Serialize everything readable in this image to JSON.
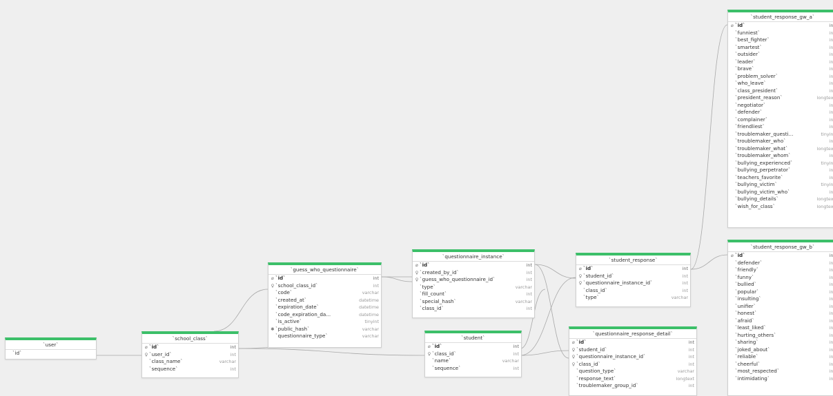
{
  "colors": {
    "canvas": "#efefef",
    "header_accent": "#3cbf69",
    "edge": "#a8a8a8"
  },
  "tables": [
    {
      "id": "user",
      "title": "`user`",
      "columns": [
        {
          "name": "`id`",
          "type": "",
          "key": ""
        }
      ]
    },
    {
      "id": "school_class",
      "title": "`school_class`",
      "columns": [
        {
          "name": "`id`",
          "type": "int",
          "key": "pk"
        },
        {
          "name": "`user_id`",
          "type": "int",
          "key": "fk"
        },
        {
          "name": "`class_name`",
          "type": "varchar",
          "key": ""
        },
        {
          "name": "`sequence`",
          "type": "int",
          "key": ""
        }
      ]
    },
    {
      "id": "guess_who_questionnaire",
      "title": "`guess_who_questionnaire`",
      "columns": [
        {
          "name": "`id`",
          "type": "int",
          "key": "pk"
        },
        {
          "name": "`school_class_id`",
          "type": "int",
          "key": "fk"
        },
        {
          "name": "`code`",
          "type": "varchar",
          "key": ""
        },
        {
          "name": "`created_at`",
          "type": "datetime",
          "key": ""
        },
        {
          "name": "`expiration_date`",
          "type": "datetime",
          "key": ""
        },
        {
          "name": "`code_expiration_da...",
          "type": "datetime",
          "key": ""
        },
        {
          "name": "`is_active`",
          "type": "tinyint",
          "key": ""
        },
        {
          "name": "`public_hash`",
          "type": "varchar",
          "key": "uq"
        },
        {
          "name": "`questionnaire_type`",
          "type": "varchar",
          "key": ""
        }
      ]
    },
    {
      "id": "questionnaire_instance",
      "title": "`questionnaire_instance`",
      "columns": [
        {
          "name": "`id`",
          "type": "int",
          "key": "pk"
        },
        {
          "name": "`created_by_id`",
          "type": "int",
          "key": "fk"
        },
        {
          "name": "`guess_who_questionnaire_id`",
          "type": "int",
          "key": "fk"
        },
        {
          "name": "`type`",
          "type": "varchar",
          "key": ""
        },
        {
          "name": "`fill_count`",
          "type": "int",
          "key": ""
        },
        {
          "name": "`special_hash`",
          "type": "varchar",
          "key": ""
        },
        {
          "name": "`class_id`",
          "type": "int",
          "key": ""
        }
      ]
    },
    {
      "id": "student",
      "title": "`student`",
      "columns": [
        {
          "name": "`id`",
          "type": "int",
          "key": "pk"
        },
        {
          "name": "`class_id`",
          "type": "int",
          "key": "fk"
        },
        {
          "name": "`name`",
          "type": "varchar",
          "key": ""
        },
        {
          "name": "`sequence`",
          "type": "int",
          "key": ""
        }
      ]
    },
    {
      "id": "student_response",
      "title": "`student_response`",
      "columns": [
        {
          "name": "`id`",
          "type": "int",
          "key": "pk"
        },
        {
          "name": "`student_id`",
          "type": "int",
          "key": "fk"
        },
        {
          "name": "`questionnaire_instance_id`",
          "type": "int",
          "key": "fk"
        },
        {
          "name": "`class_id`",
          "type": "int",
          "key": ""
        },
        {
          "name": "`type`",
          "type": "varchar",
          "key": ""
        }
      ]
    },
    {
      "id": "questionnaire_response_detail",
      "title": "`questionnaire_response_detail`",
      "columns": [
        {
          "name": "`id`",
          "type": "int",
          "key": "pk"
        },
        {
          "name": "`student_id`",
          "type": "int",
          "key": "fk"
        },
        {
          "name": "`questionnaire_instance_id`",
          "type": "int",
          "key": "fk"
        },
        {
          "name": "`class_id`",
          "type": "int",
          "key": "fk"
        },
        {
          "name": "`question_type`",
          "type": "varchar",
          "key": ""
        },
        {
          "name": "`response_text`",
          "type": "longtext",
          "key": ""
        },
        {
          "name": "`troublemaker_group_id`",
          "type": "int",
          "key": ""
        }
      ]
    },
    {
      "id": "student_response_gw_a",
      "title": "`student_response_gw_a`",
      "columns": [
        {
          "name": "`id`",
          "type": "int",
          "key": "pkfk"
        },
        {
          "name": "`funniest`",
          "type": "int",
          "key": ""
        },
        {
          "name": "`best_fighter`",
          "type": "int",
          "key": ""
        },
        {
          "name": "`smartest`",
          "type": "int",
          "key": ""
        },
        {
          "name": "`outsider`",
          "type": "int",
          "key": ""
        },
        {
          "name": "`leader`",
          "type": "int",
          "key": ""
        },
        {
          "name": "`brave`",
          "type": "int",
          "key": ""
        },
        {
          "name": "`problem_solver`",
          "type": "int",
          "key": ""
        },
        {
          "name": "`who_leave`",
          "type": "int",
          "key": ""
        },
        {
          "name": "`class_president`",
          "type": "int",
          "key": ""
        },
        {
          "name": "`president_reason`",
          "type": "longtext",
          "key": ""
        },
        {
          "name": "`negotiator`",
          "type": "int",
          "key": ""
        },
        {
          "name": "`defender`",
          "type": "int",
          "key": ""
        },
        {
          "name": "`complainer`",
          "type": "int",
          "key": ""
        },
        {
          "name": "`friendliest`",
          "type": "int",
          "key": ""
        },
        {
          "name": "`troublemaker_questi...",
          "type": "tinyint",
          "key": ""
        },
        {
          "name": "`troublemaker_who`",
          "type": "int",
          "key": ""
        },
        {
          "name": "`troublemaker_what`",
          "type": "longtext",
          "key": ""
        },
        {
          "name": "`troublemaker_whom`",
          "type": "int",
          "key": ""
        },
        {
          "name": "`bullying_experienced`",
          "type": "tinyint",
          "key": ""
        },
        {
          "name": "`bullying_perpetrator`",
          "type": "int",
          "key": ""
        },
        {
          "name": "`teachers_favorite`",
          "type": "int",
          "key": ""
        },
        {
          "name": "`bullying_victim`",
          "type": "tinyint",
          "key": ""
        },
        {
          "name": "`bullying_victim_who`",
          "type": "int",
          "key": ""
        },
        {
          "name": "`bullying_details`",
          "type": "longtext",
          "key": ""
        },
        {
          "name": "`wish_for_class`",
          "type": "longtext",
          "key": ""
        }
      ]
    },
    {
      "id": "student_response_gw_b",
      "title": "`student_response_gw_b`",
      "columns": [
        {
          "name": "`id`",
          "type": "int",
          "key": "pkfk"
        },
        {
          "name": "`defender`",
          "type": "int",
          "key": ""
        },
        {
          "name": "`friendly`",
          "type": "int",
          "key": ""
        },
        {
          "name": "`funny`",
          "type": "int",
          "key": ""
        },
        {
          "name": "`bullied`",
          "type": "int",
          "key": ""
        },
        {
          "name": "`popular`",
          "type": "int",
          "key": ""
        },
        {
          "name": "`insulting`",
          "type": "int",
          "key": ""
        },
        {
          "name": "`unifier`",
          "type": "int",
          "key": ""
        },
        {
          "name": "`honest`",
          "type": "int",
          "key": ""
        },
        {
          "name": "`afraid`",
          "type": "int",
          "key": ""
        },
        {
          "name": "`least_liked`",
          "type": "int",
          "key": ""
        },
        {
          "name": "`hurting_others`",
          "type": "int",
          "key": ""
        },
        {
          "name": "`sharing`",
          "type": "int",
          "key": ""
        },
        {
          "name": "`joked_about`",
          "type": "int",
          "key": ""
        },
        {
          "name": "`reliable`",
          "type": "int",
          "key": ""
        },
        {
          "name": "`cheerful`",
          "type": "int",
          "key": ""
        },
        {
          "name": "`most_respected`",
          "type": "int",
          "key": ""
        },
        {
          "name": "`intimidating`",
          "type": "int",
          "key": ""
        }
      ]
    }
  ]
}
